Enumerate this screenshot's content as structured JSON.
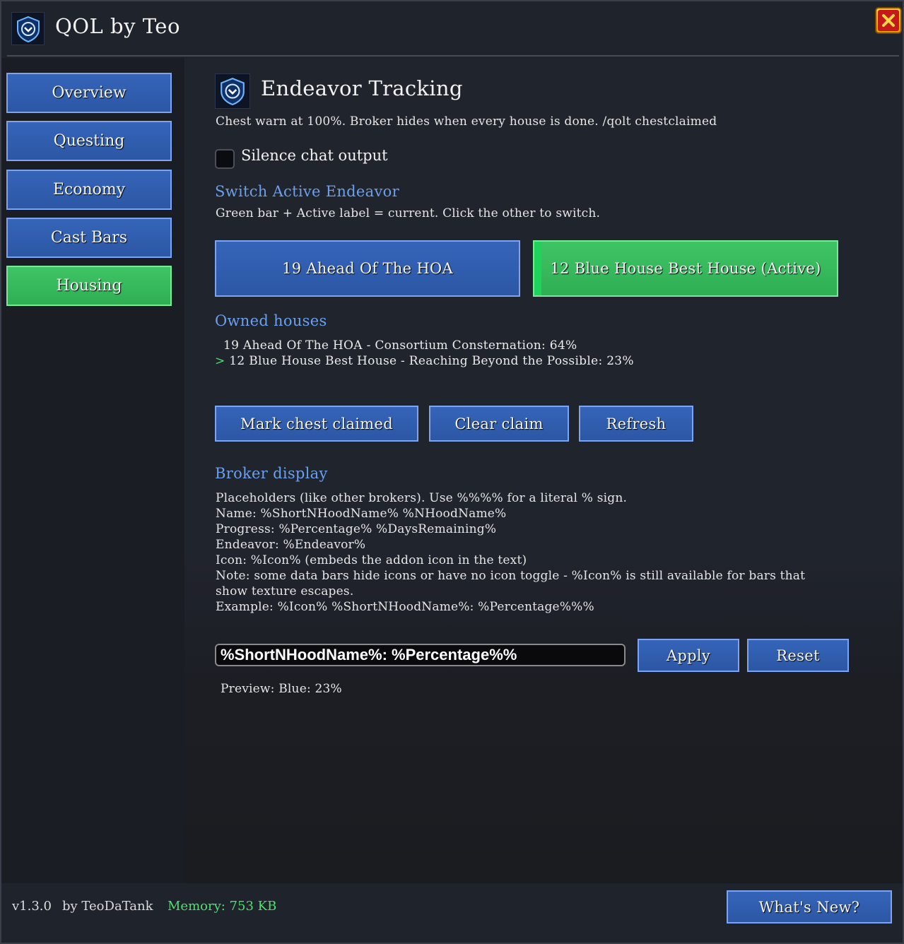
{
  "app": {
    "title": "QOL by Teo",
    "logo_icon": "shield-chevron-icon",
    "close_icon": "close-x-icon"
  },
  "sidebar": {
    "items": [
      {
        "label": "Overview",
        "active": false
      },
      {
        "label": "Questing",
        "active": false
      },
      {
        "label": "Economy",
        "active": false
      },
      {
        "label": "Cast Bars",
        "active": false
      },
      {
        "label": "Housing",
        "active": true
      }
    ]
  },
  "page": {
    "title": "Endeavor Tracking",
    "section_icon": "shield-chevron-icon",
    "intro": "Chest warn at 100%. Broker hides when every house is done.  /qolt chestclaimed",
    "silence_checkbox": {
      "label": "Silence chat output",
      "checked": false
    }
  },
  "switch_section": {
    "heading": "Switch Active Endeavor",
    "description": "Green bar + Active label = current. Click the other to switch.",
    "buttons": [
      {
        "label": "19 Ahead Of The HOA",
        "active": false
      },
      {
        "label": "12 Blue House Best House  (Active)",
        "active": true
      }
    ]
  },
  "owned_section": {
    "heading": "Owned houses",
    "houses": [
      {
        "marker": "",
        "text": "19 Ahead Of The HOA - Consortium Consternation: 64%"
      },
      {
        "marker": ">",
        "text": "12 Blue House Best House - Reaching Beyond the Possible: 23%"
      }
    ]
  },
  "actions": {
    "mark_claimed": "Mark chest claimed",
    "clear_claim": "Clear claim",
    "refresh": "Refresh"
  },
  "broker_section": {
    "heading": "Broker display",
    "lines": [
      "Placeholders (like other brokers). Use %%%% for a literal % sign.",
      "Name:  %ShortNHoodName%   %NHoodName%",
      "Progress:  %Percentage%   %DaysRemaining%",
      "Endeavor:  %Endeavor%",
      "Icon:  %Icon%   (embeds the addon icon in the text)",
      "Note: some data bars hide icons or have no icon toggle - %Icon% is still available for bars that",
      "show texture escapes.",
      "Example: %Icon% %ShortNHoodName%: %Percentage%%%"
    ],
    "input_value": "%ShortNHoodName%: %Percentage%%",
    "apply": "Apply",
    "reset": "Reset",
    "preview": "Preview: Blue: 23%"
  },
  "footer": {
    "version": "v1.3.0",
    "author": "by TeoDaTank",
    "memory": "Memory: 753 KB",
    "whats_new": "What's New?"
  },
  "colors": {
    "button_blue": "#2f5cad",
    "button_active_green": "#35b95a",
    "heading_blue": "#6aa0ee",
    "memory_green": "#4fe06e"
  }
}
